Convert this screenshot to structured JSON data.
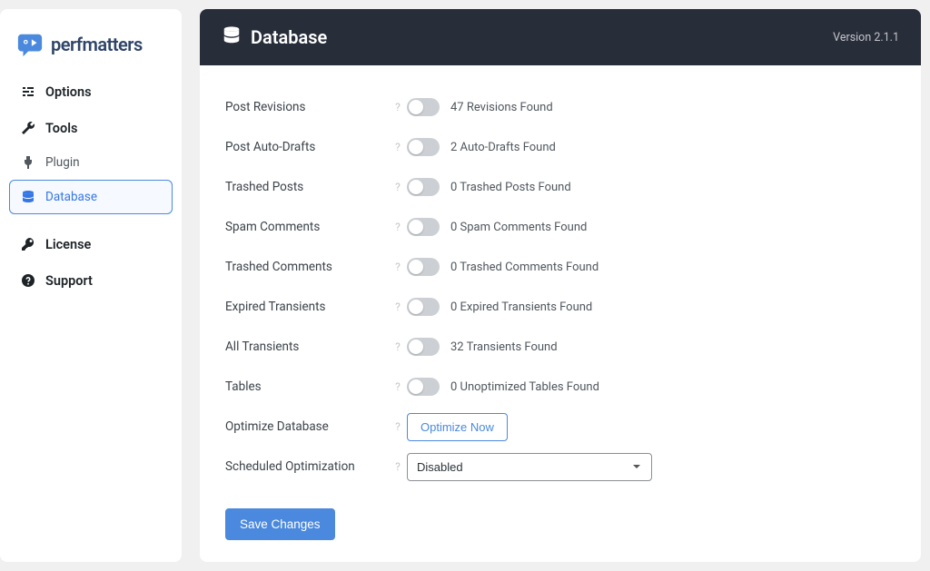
{
  "brand": {
    "name": "perfmatters"
  },
  "sidebar": {
    "items": [
      {
        "label": "Options"
      },
      {
        "label": "Tools"
      },
      {
        "label": "Plugin"
      },
      {
        "label": "Database"
      },
      {
        "label": "License"
      },
      {
        "label": "Support"
      }
    ]
  },
  "header": {
    "title": "Database",
    "version": "Version 2.1.1"
  },
  "settings": {
    "rows": [
      {
        "label": "Post Revisions",
        "status": "47 Revisions Found"
      },
      {
        "label": "Post Auto-Drafts",
        "status": "2 Auto-Drafts Found"
      },
      {
        "label": "Trashed Posts",
        "status": "0 Trashed Posts Found"
      },
      {
        "label": "Spam Comments",
        "status": "0 Spam Comments Found"
      },
      {
        "label": "Trashed Comments",
        "status": "0 Trashed Comments Found"
      },
      {
        "label": "Expired Transients",
        "status": "0 Expired Transients Found"
      },
      {
        "label": "All Transients",
        "status": "32 Transients Found"
      },
      {
        "label": "Tables",
        "status": "0 Unoptimized Tables Found"
      }
    ],
    "optimize_label": "Optimize Database",
    "optimize_button": "Optimize Now",
    "schedule_label": "Scheduled Optimization",
    "schedule_value": "Disabled",
    "save_label": "Save Changes",
    "help_char": "?"
  }
}
